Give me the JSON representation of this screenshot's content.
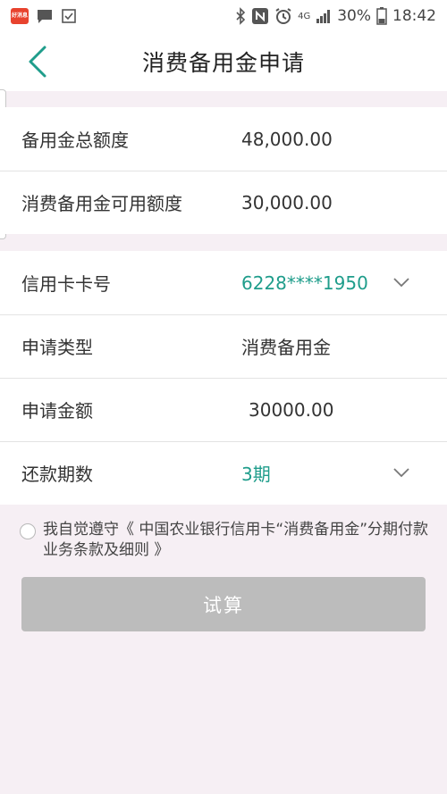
{
  "status_bar": {
    "left_icons": [
      "app-badge-icon",
      "message-icon",
      "checkbox-icon"
    ],
    "app_badge_text": "好消息",
    "network": "4G",
    "battery": "30%",
    "time": "18:42"
  },
  "header": {
    "title": "消费备用金申请",
    "back_icon": "chevron-left-icon",
    "accent_color": "#1f9d8b"
  },
  "quota_section": {
    "rows": [
      {
        "label": "备用金总额度",
        "value": "48,000.00"
      },
      {
        "label": "消费备用金可用额度",
        "value": "30,000.00"
      }
    ]
  },
  "form_section": {
    "card": {
      "label": "信用卡卡号",
      "value": "6228****1950"
    },
    "type": {
      "label": "申请类型",
      "value": "消费备用金"
    },
    "amount": {
      "label": "申请金额",
      "value": "30000.00"
    },
    "term": {
      "label": "还款期数",
      "value": "3期"
    }
  },
  "agreement": {
    "prefix": "我自觉遵守",
    "link": "《 中国农业银行信用卡“消费备用金”分期付款业务条款及细则 》"
  },
  "actions": {
    "calculate_label": "试算",
    "button_color": "#bcbcbc"
  }
}
